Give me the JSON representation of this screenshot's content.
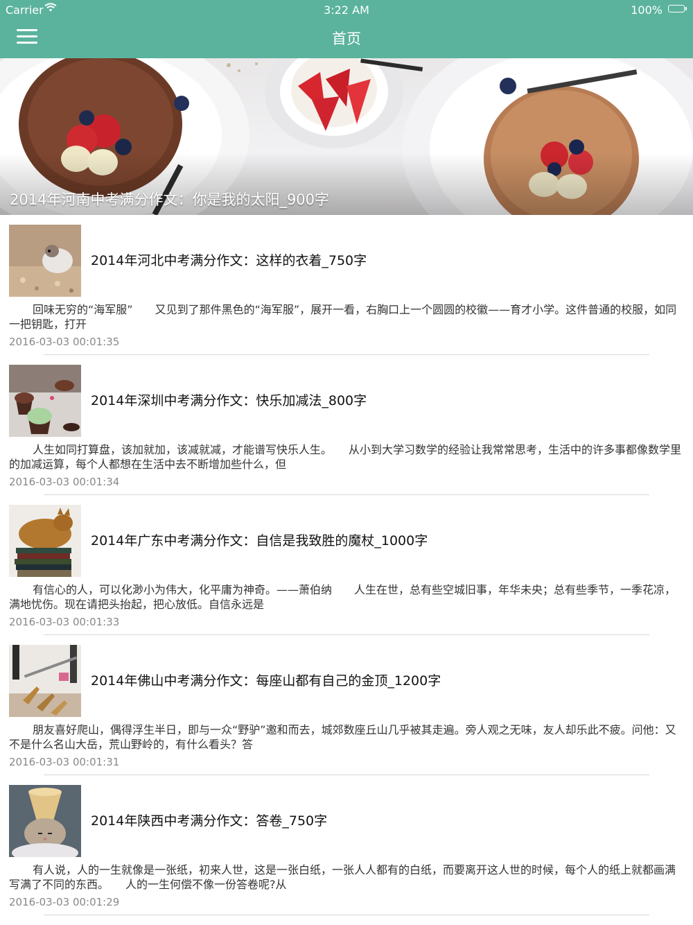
{
  "status_bar": {
    "carrier": "Carrier",
    "time": "3:22 AM",
    "battery": "100%"
  },
  "nav": {
    "title": "首页"
  },
  "hero": {
    "title": "2014年河南中考满分作文：你是我的太阳_900字"
  },
  "articles": [
    {
      "title": "2014年河北中考满分作文：这样的衣着_750字",
      "summary": "回味无穷的“海军服”　　又见到了那件黑色的“海军服”，展开一看，右胸口上一个圆圆的校徽——育才小学。这件普通的校服，如同一把钥匙，打开",
      "date": "2016-03-03 00:01:35"
    },
    {
      "title": "2014年深圳中考满分作文：快乐加减法_800字",
      "summary": "人生如同打算盘，该加就加，该减就减，才能谱写快乐人生。　　从小到大学习数学的经验让我常常思考，生活中的许多事都像数学里的加减运算，每个人都想在生活中去不断增加些什么，但",
      "date": "2016-03-03 00:01:34"
    },
    {
      "title": "2014年广东中考满分作文：自信是我致胜的魔杖_1000字",
      "summary": "有信心的人，可以化渺小为伟大，化平庸为神奇。——萧伯纳　　人生在世，总有些空城旧事，年华未央；总有些季节，一季花凉，满地忧伤。现在请把头抬起，把心放低。自信永远是",
      "date": "2016-03-03 00:01:33"
    },
    {
      "title": "2014年佛山中考满分作文：每座山都有自己的金顶_1200字",
      "summary": "朋友喜好爬山，偶得浮生半日，即与一众“野驴”邀和而去，城郊数座丘山几乎被其走遍。旁人观之无味，友人却乐此不疲。问他：又不是什么名山大岳，荒山野岭的，有什么看头？答",
      "date": "2016-03-03 00:01:31"
    },
    {
      "title": "2014年陕西中考满分作文：答卷_750字",
      "summary": "有人说，人的一生就像是一张纸，初来人世，这是一张白纸，一张人人都有的白纸，而要离开这人世的时候，每个人的纸上就都画满写满了不同的东西。　　人的一生何偿不像一份答卷呢?从",
      "date": "2016-03-03 00:01:29"
    }
  ],
  "colors": {
    "nav_bar": "#5bb39d",
    "divider": "#d8d8d8",
    "date_text": "#888888"
  }
}
